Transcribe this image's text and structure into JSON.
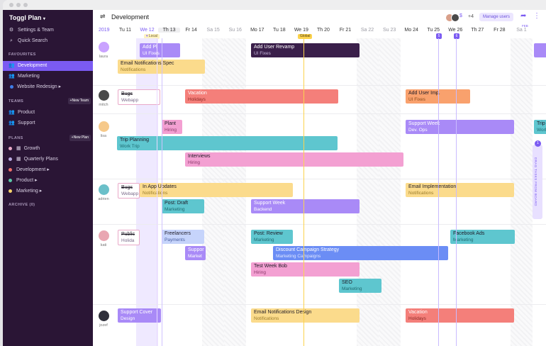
{
  "app": {
    "brand": "Toggl Plan",
    "settings": "Settings & Team",
    "quick_search": "Quick Search"
  },
  "sidebar": {
    "favourites_heading": "FAVOURITES",
    "favourites": [
      "Development",
      "Marketing",
      "Website Redesign"
    ],
    "teams_heading": "TEAMS",
    "new_team": "+New Team",
    "teams": [
      "Product",
      "Support"
    ],
    "plans_heading": "PLANS",
    "new_plan": "+New Plan",
    "plans": [
      {
        "label": "Growth",
        "color": "#e9a9c8"
      },
      {
        "label": "Quarterly Plans",
        "color": "#b9a9e0"
      },
      {
        "label": "Development",
        "color": "#ef6f6a"
      },
      {
        "label": "Product",
        "color": "#5cc7a8"
      },
      {
        "label": "Marketing",
        "color": "#f6d36b"
      }
    ],
    "archive": "ARCHIVE (0)"
  },
  "header": {
    "title": "Development",
    "plus_count": "+4",
    "manage_users": "Manage users",
    "year": "2019",
    "local_badge": "Local",
    "global_badge": "Global",
    "feb_marker": "FEB",
    "marker_5": "5",
    "marker_6": "6"
  },
  "days": [
    {
      "label": "Tu 11",
      "weekend": false
    },
    {
      "label": "We 12",
      "weekend": false,
      "today": true
    },
    {
      "label": "Th 13",
      "weekend": false
    },
    {
      "label": "Fr 14",
      "weekend": false
    },
    {
      "label": "Sa 15",
      "weekend": true
    },
    {
      "label": "Su 16",
      "weekend": true
    },
    {
      "label": "Mo 17",
      "weekend": false
    },
    {
      "label": "Tu 18",
      "weekend": false
    },
    {
      "label": "We 19",
      "weekend": false
    },
    {
      "label": "Th 20",
      "weekend": false
    },
    {
      "label": "Fr 21",
      "weekend": false
    },
    {
      "label": "Sa 22",
      "weekend": true
    },
    {
      "label": "Su 23",
      "weekend": true
    },
    {
      "label": "Mo 24",
      "weekend": false
    },
    {
      "label": "Tu 25",
      "weekend": false
    },
    {
      "label": "We 26",
      "weekend": false
    },
    {
      "label": "Th 27",
      "weekend": false
    },
    {
      "label": "Fr 28",
      "weekend": false
    },
    {
      "label": "Sa 1",
      "weekend": true
    }
  ],
  "users": [
    "laura",
    "mitch",
    "lisa",
    "adrien",
    "kati",
    "jozef"
  ],
  "tasks": [
    {
      "title": "Add Pl",
      "sub": "UI Fixes",
      "bg": "#a98af7",
      "sc": "#ffffff",
      "tc": "#ffffff"
    },
    {
      "title": "Add User Revamp",
      "sub": "UI Fixes",
      "bg": "#3a1f4a",
      "sc": "#c7b8dd",
      "tc": "#ffffff"
    },
    {
      "title": "Email Notifications Spec",
      "sub": "Notifications",
      "bg": "#fbdb8c",
      "sc": "#9a7b2a"
    },
    {
      "title": "Bugs",
      "sub": "Webapp",
      "bg": "#ffffff",
      "sc": "#7a6a8a",
      "done": true
    },
    {
      "title": "Vacation",
      "sub": "Holidays",
      "bg": "#f47f7a",
      "sc": "#8d2b27",
      "tc": "#ffffff"
    },
    {
      "title": "Add User Imp.",
      "sub": "UI Fixes",
      "bg": "#f9a16d",
      "sc": "#8a4a1c"
    },
    {
      "title": "Plant",
      "sub": "Hiring",
      "bg": "#f3a0d2",
      "sc": "#8a3a6a"
    },
    {
      "title": "Support Week",
      "sub": "Dev. Ops",
      "bg": "#a98af7",
      "sc": "#ffffff",
      "tc": "#ffffff"
    },
    {
      "title": "Trip Planning",
      "sub": "Work Trip",
      "bg": "#5ec6cf",
      "sc": "#1f6a70"
    },
    {
      "title": "Interviews",
      "sub": "Hiring",
      "bg": "#f3a0d2",
      "sc": "#8a3a6a"
    },
    {
      "title": "Bugs",
      "sub": "Webapp",
      "bg": "#ffffff",
      "sc": "#7a6a8a",
      "done": true
    },
    {
      "title": "In App Updates",
      "sub": "Notifications",
      "bg": "#fbdb8c",
      "sc": "#9a7b2a"
    },
    {
      "title": "Email Implementation",
      "sub": "Notifications",
      "bg": "#fbdb8c",
      "sc": "#9a7b2a"
    },
    {
      "title": "Post: Draft",
      "sub": "Marketing",
      "bg": "#5ec6cf",
      "sc": "#1f6a70"
    },
    {
      "title": "Support Week",
      "sub": "Backend",
      "bg": "#a98af7",
      "sc": "#ffffff",
      "tc": "#ffffff"
    },
    {
      "title": "Public",
      "sub": "Holida",
      "bg": "#ffffff",
      "sc": "#7a6a8a",
      "done": true
    },
    {
      "title": "Freelancers",
      "sub": "Payments",
      "bg": "#c6d4fb",
      "sc": "#4a5fa0"
    },
    {
      "title": "Post: Review",
      "sub": "Marketing",
      "bg": "#5ec6cf",
      "sc": "#1f6a70"
    },
    {
      "title": "Facebook Ads",
      "sub": "Marketing",
      "bg": "#5ec6cf",
      "sc": "#1f6a70"
    },
    {
      "title": "Suppor",
      "sub": "Market",
      "bg": "#a98af7",
      "sc": "#ffffff",
      "tc": "#ffffff"
    },
    {
      "title": "Discount Campaign Strategy",
      "sub": "Marketing Campaigns",
      "bg": "#6b8df5",
      "sc": "#dfe6ff",
      "tc": "#ffffff"
    },
    {
      "title": "Test Week Bob",
      "sub": "Hiring",
      "bg": "#f3a0d2",
      "sc": "#8a3a6a"
    },
    {
      "title": "SEO",
      "sub": "Marketing",
      "bg": "#5ec6cf",
      "sc": "#1f6a70"
    },
    {
      "title": "Support Cover",
      "sub": "Design",
      "bg": "#a98af7",
      "sc": "#ffffff",
      "tc": "#ffffff"
    },
    {
      "title": "Email Notifications Design",
      "sub": "Notifications",
      "bg": "#fbdb8c",
      "sc": "#9a7b2a"
    },
    {
      "title": "Vacation",
      "sub": "Holidays",
      "bg": "#f47f7a",
      "sc": "#8d2b27",
      "tc": "#ffffff"
    },
    {
      "title": "Trip",
      "sub": "Work",
      "bg": "#5ec6cf",
      "sc": "#1f6a70"
    },
    {
      "title": "",
      "sub": "",
      "bg": "#a98af7",
      "sc": "#ffffff"
    }
  ],
  "drag_panel": {
    "label": "DRAG TASKS FROM BOARD",
    "count": "1"
  }
}
